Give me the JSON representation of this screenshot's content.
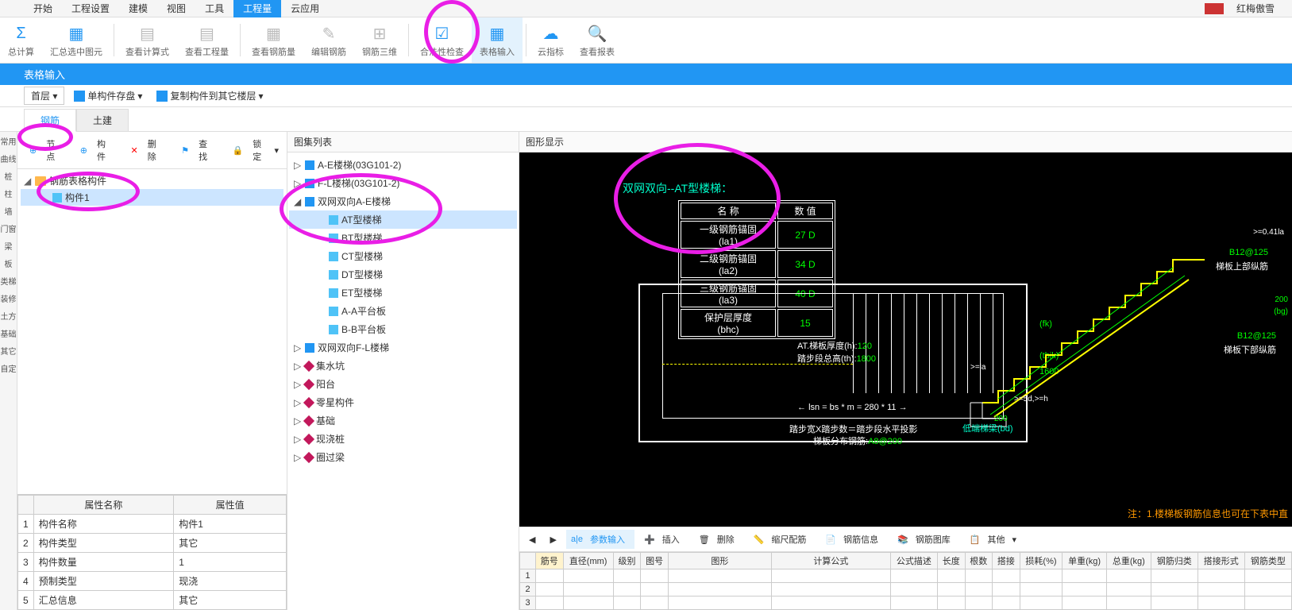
{
  "user": "红梅傲雪",
  "menus": [
    "开始",
    "工程设置",
    "建模",
    "视图",
    "工具",
    "工程量",
    "云应用"
  ],
  "active_menu": 5,
  "ribbon": [
    {
      "label": "总计算",
      "color": "#2196F3"
    },
    {
      "label": "汇总选中图元",
      "color": "#2196F3"
    },
    {
      "label": "查看计算式",
      "color": "#90A4AE"
    },
    {
      "label": "查看工程量",
      "color": "#90A4AE"
    },
    {
      "label": "查看钢筋量",
      "color": "#90A4AE"
    },
    {
      "label": "编辑钢筋",
      "color": "#90A4AE"
    },
    {
      "label": "钢筋三维",
      "color": "#90A4AE"
    },
    {
      "label": "合法性检查",
      "color": "#2196F3"
    },
    {
      "label": "表格输入",
      "color": "#2196F3",
      "highlight": true
    },
    {
      "label": "云指标",
      "color": "#2196F3"
    },
    {
      "label": "查看报表",
      "color": "#2196F3"
    }
  ],
  "blue_bar": "表格输入",
  "floor_selector": "首层",
  "toolbar2": {
    "save": "单构件存盘",
    "copy": "复制构件到其它楼层"
  },
  "tabs": [
    "钢筋",
    "土建"
  ],
  "active_tab": 0,
  "tree_toolbar": {
    "node": "节点",
    "component": "构件",
    "delete": "删除",
    "find": "查找",
    "lock": "锁定"
  },
  "tree_root": "钢筋表格构件",
  "tree_child": "构件1",
  "prop_cols": [
    "属性名称",
    "属性值"
  ],
  "props": [
    {
      "n": "1",
      "name": "构件名称",
      "val": "构件1"
    },
    {
      "n": "2",
      "name": "构件类型",
      "val": "其它"
    },
    {
      "n": "3",
      "name": "构件数量",
      "val": "1"
    },
    {
      "n": "4",
      "name": "预制类型",
      "val": "现浇"
    },
    {
      "n": "5",
      "name": "汇总信息",
      "val": "其它"
    }
  ],
  "mid_header": "图集列表",
  "mid_tree": [
    {
      "exp": "▷",
      "type": "book",
      "label": "A-E楼梯(03G101-2)",
      "indent": 0
    },
    {
      "exp": "▷",
      "type": "book",
      "label": "F-L楼梯(03G101-2)",
      "indent": 0
    },
    {
      "exp": "◢",
      "type": "book",
      "label": "双网双向A-E楼梯",
      "indent": 0
    },
    {
      "exp": "",
      "type": "doc",
      "label": "AT型楼梯",
      "indent": 1,
      "sel": true
    },
    {
      "exp": "",
      "type": "doc",
      "label": "BT型楼梯",
      "indent": 1
    },
    {
      "exp": "",
      "type": "doc",
      "label": "CT型楼梯",
      "indent": 1
    },
    {
      "exp": "",
      "type": "doc",
      "label": "DT型楼梯",
      "indent": 1
    },
    {
      "exp": "",
      "type": "doc",
      "label": "ET型楼梯",
      "indent": 1
    },
    {
      "exp": "",
      "type": "doc",
      "label": "A-A平台板",
      "indent": 1
    },
    {
      "exp": "",
      "type": "doc",
      "label": "B-B平台板",
      "indent": 1
    },
    {
      "exp": "▷",
      "type": "book",
      "label": "双网双向F-L楼梯",
      "indent": 0
    },
    {
      "exp": "▷",
      "type": "diamond",
      "label": "集水坑",
      "indent": 0
    },
    {
      "exp": "▷",
      "type": "diamond",
      "label": "阳台",
      "indent": 0
    },
    {
      "exp": "▷",
      "type": "diamond",
      "label": "零星构件",
      "indent": 0
    },
    {
      "exp": "▷",
      "type": "diamond",
      "label": "基础",
      "indent": 0
    },
    {
      "exp": "▷",
      "type": "diamond",
      "label": "现浇桩",
      "indent": 0
    },
    {
      "exp": "▷",
      "type": "diamond",
      "label": "圈过梁",
      "indent": 0
    }
  ],
  "right_header": "图形显示",
  "diagram": {
    "title": "双网双向--AT型楼梯：",
    "table_head": [
      "名 称",
      "数 值"
    ],
    "table_rows": [
      {
        "name": "一级钢筋锚固(la1)",
        "val": "27 D"
      },
      {
        "name": "二级钢筋锚固(la2)",
        "val": "34 D"
      },
      {
        "name": "三级钢筋锚固(la3)",
        "val": "40 D"
      },
      {
        "name": "保护层厚度(bhc)",
        "val": "15"
      }
    ],
    "thickness_label": "AT.梯板厚度(h):",
    "thickness_val": "120",
    "height_label": "踏步段总高(th):",
    "height_val": "1800",
    "dims": {
      "fk": "(fk)",
      "tbjk": "(tbjk)",
      "h1600": "1600"
    },
    "lsn": "lsn = bs * m = 280 * 11",
    "bottom1": "踏步宽X踏步数＝踏步段水平投影",
    "bottom2_label": "梯板分布钢筋:",
    "bottom2_val": "A8@200",
    "top_rebar_spec": "B12@125",
    "top_rebar_label": "梯板上部纵筋",
    "bot_rebar_spec": "B12@125",
    "bot_rebar_label": "梯板下部纵筋",
    "low_beam": "低端梯梁(bd)",
    "dim_la": ">=la",
    "dim_5d": ">=5d,>=h",
    "dim_200": "200",
    "dim_041la": ">=0.41la",
    "dim_bg": "(bg)",
    "dim_200r": "200",
    "note": "注：1.楼梯板钢筋信息也可在下表中直"
  },
  "side_labels": [
    "常用",
    "曲线",
    "桩",
    "柱",
    "墙",
    "门窗",
    "梁",
    "板",
    "类梯",
    "装修",
    "土方",
    "基础",
    "其它",
    "自定"
  ],
  "bottom_toolbar": {
    "param": "参数输入",
    "insert": "插入",
    "delete": "删除",
    "scale": "缩尺配筋",
    "info": "钢筋信息",
    "lib": "钢筋图库",
    "other": "其他"
  },
  "rebar_cols": [
    "筋号",
    "直径(mm)",
    "级别",
    "图号",
    "图形",
    "计算公式",
    "公式描述",
    "长度",
    "根数",
    "搭接",
    "损耗(%)",
    "单重(kg)",
    "总重(kg)",
    "钢筋归类",
    "搭接形式",
    "钢筋类型"
  ]
}
